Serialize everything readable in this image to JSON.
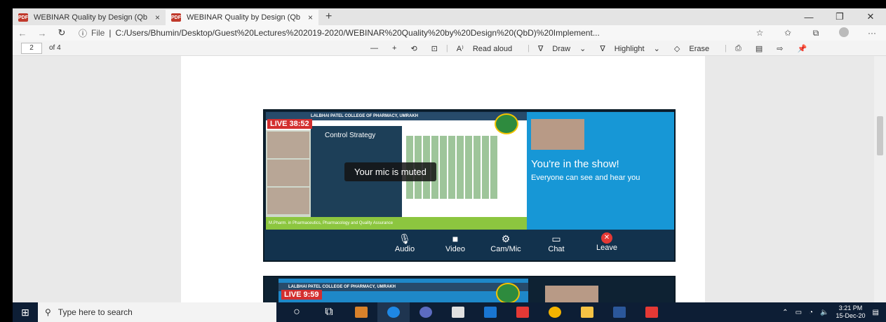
{
  "browser": {
    "tabs": [
      {
        "label": "WEBINAR Quality by Design (Qb",
        "close": "×"
      },
      {
        "label": "WEBINAR Quality by Design (Qb",
        "close": "×"
      }
    ],
    "new_tab": "+",
    "window_controls": {
      "minimize": "—",
      "restore": "❐",
      "close": "✕"
    },
    "address": {
      "file_label": "File",
      "url": "C:/Users/Bhumin/Desktop/Guest%20Lectures%202019-2020/WEBINAR%20Quality%20by%20Design%20(QbD)%20Implement..."
    }
  },
  "pdf_toolbar": {
    "page": "2",
    "of": "of 4",
    "read_aloud": "Read aloud",
    "draw": "Draw",
    "highlight": "Highlight",
    "erase": "Erase"
  },
  "meeting1": {
    "college": "LALBHAI PATEL COLLEGE OF PHARMACY, UMRAKH",
    "live": "LIVE 38:52",
    "slide_title": "Control Strategy",
    "muted": "Your mic is muted",
    "show_title": "You're in the show!",
    "show_sub": "Everyone can see and hear you",
    "footer": "M.Pharm. in Pharmaceutics, Pharmacology and Quality Assurance",
    "controls": [
      {
        "icon": "🎙",
        "label": "Audio"
      },
      {
        "icon": "■",
        "label": "Video"
      },
      {
        "icon": "⚙",
        "label": "Cam/Mic"
      },
      {
        "icon": "▭",
        "label": "Chat"
      },
      {
        "icon": "✕",
        "label": "Leave"
      }
    ]
  },
  "meeting2": {
    "college": "LALBHAI PATEL COLLEGE OF PHARMACY, UMRAKH",
    "live": "LIVE 9:59"
  },
  "taskbar": {
    "search_placeholder": "Type here to search",
    "time": "3:21 PM",
    "date": "15-Dec-20"
  }
}
